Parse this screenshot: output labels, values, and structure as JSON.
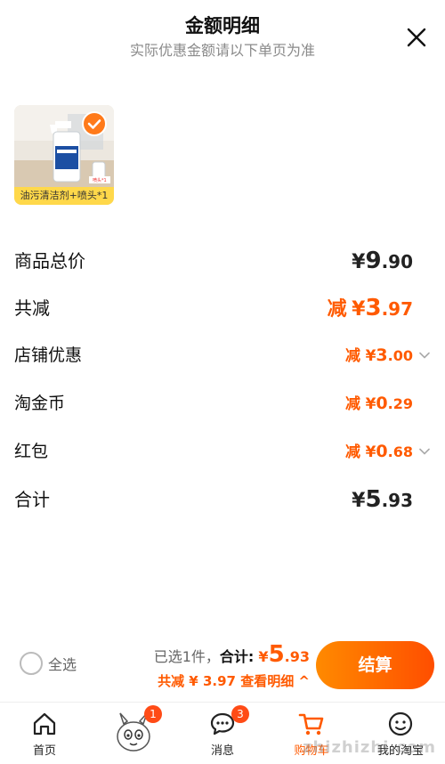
{
  "header": {
    "title": "金额明细",
    "subtitle": "实际优惠金额请以下单页为准"
  },
  "product": {
    "label": "油污清洁剂+喷头*1",
    "tag_text": "喷头*1"
  },
  "rows": {
    "total": {
      "label": "商品总价",
      "currency": "¥",
      "int": "9",
      "dec": ".90"
    },
    "discount": {
      "label": "共减",
      "prefix": "减",
      "currency": "¥",
      "int": "3",
      "dec": ".97"
    },
    "store": {
      "label": "店铺优惠",
      "prefix": "减",
      "currency": "¥",
      "int": "3",
      "dec": ".00"
    },
    "coin": {
      "label": "淘金币",
      "prefix": "减",
      "currency": "¥",
      "int": "0",
      "dec": ".29"
    },
    "redpacket": {
      "label": "红包",
      "prefix": "减",
      "currency": "¥",
      "int": "0",
      "dec": ".68"
    },
    "sum": {
      "label": "合计",
      "currency": "¥",
      "int": "5",
      "dec": ".93"
    }
  },
  "footer": {
    "select_all": "全选",
    "selected_text": "已选1件，",
    "total_label": "合计:",
    "currency": "¥",
    "total_int": "5",
    "total_dec": ".93",
    "discount_text": "共减 ¥ 3.97",
    "detail_link": "查看明细 ^",
    "checkout": "结算"
  },
  "tabbar": {
    "tabs": [
      {
        "label": "首页",
        "icon": "home-icon",
        "badge": ""
      },
      {
        "label": "",
        "icon": "mascot-icon",
        "badge": "1"
      },
      {
        "label": "消息",
        "icon": "message-icon",
        "badge": "3"
      },
      {
        "label": "购物车",
        "icon": "cart-icon",
        "badge": ""
      },
      {
        "label": "我的淘宝",
        "icon": "profile-icon",
        "badge": ""
      }
    ]
  },
  "watermark": "zhizhizhi.com",
  "colors": {
    "accent": "#ff5a00",
    "badge": "#ff4b16",
    "label_bg": "#ffd84a"
  }
}
